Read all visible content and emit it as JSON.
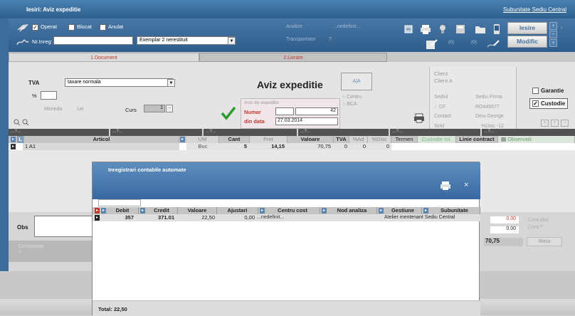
{
  "window": {
    "title": "Iesiri: Aviz expeditie",
    "subunit_link": "Subunitate Sediu Central"
  },
  "toolbar": {
    "operat": "Operat",
    "operat_checked": "✓",
    "blocat": "Blocat",
    "anulat": "Anulat",
    "nr_inreg": "Nr.Inreg:",
    "exemplar": "Exemplar 2 nerestituit",
    "analize": "Analize",
    "analize_val": "...nedefinit...",
    "transportator": "Transportator",
    "transportator_val": "?",
    "count_a": "(0)",
    "count_b": "(0)",
    "iesire": "Iesire",
    "modific": "Modific"
  },
  "tabs": {
    "document": "1.Document",
    "livrare": "2.Livrare"
  },
  "document": {
    "tva_label": "TVA",
    "tva_value": "taxare normala",
    "percent": "%",
    "moneda_label": "Moneda",
    "moneda_value": "Lei",
    "curs_label": "Curs",
    "curs_value": "1",
    "curs_btn": "...",
    "title": "Aviz expeditie",
    "subtitle": "Aviz de expeditie",
    "numar_label": "Numar",
    "numar_value": "42",
    "data_label": "din data",
    "data_value": "27.03.2014",
    "icon_text": "A|A",
    "centru": "Centru",
    "bca": "BCA",
    "client_label": "Client",
    "client_value": "Client A",
    "sediul": "Sediul",
    "sediu_value": "Sediu Firma",
    "cf": "CF",
    "cf_value": "RO445577",
    "contact": "Contact",
    "contact_value": "Dinu George",
    "sold": "Sold",
    "discount": "%Disc -12",
    "garantie": "Garantie",
    "custodie": "Custodie",
    "custodie_checked": "✓"
  },
  "filter_row": [
    "...?...",
    "...?...",
    "...?...",
    "...?...",
    "...?...",
    "...?..."
  ],
  "main_table": {
    "headers": {
      "l": "L",
      "articol": "Articol",
      "um": "UM",
      "cant": "Cant",
      "pret": "Pret",
      "valoare": "Valoare",
      "tva": "TVA",
      "ad": "%Ad",
      "disc": "%Disc",
      "termen": "Termen",
      "custodie_int": "Custodie Int.",
      "linie_contract": "Linie contract",
      "observatii": "Observatii"
    },
    "row": {
      "articol": "1 A1",
      "um": "Buc",
      "cant": "5",
      "pret": "14,15",
      "valoare": "70,75",
      "tva": "0",
      "ad": "0",
      "disc": "0"
    }
  },
  "bottom": {
    "obs_label": "Obs",
    "comision_label": "Comisionar",
    "comision_value": "?"
  },
  "right_values": {
    "v1": "0.00",
    "v2": "0.00",
    "total": "70,75",
    "cont_disc": "Cont disc",
    "cont": "Cont ?",
    "masa": "Masa"
  },
  "modal": {
    "title": "Inregistrari contabile automate",
    "close": "×",
    "headers": [
      "Debit",
      "Credit",
      "Valoare",
      "Ajustari",
      "Centru cost",
      "Nod analiza",
      "Gestiune",
      "Subunitate"
    ],
    "row": {
      "debit": "357",
      "credit": "371.01",
      "valoare": "22,50",
      "ajustari": "0,00",
      "centru": "...nedefinit...",
      "gestiune": "Atelier mentenant Sediu Central"
    },
    "total": "Total: 22,50"
  },
  "colors": {
    "title_blue": "#2d5f8e",
    "accent_red": "#c0392b",
    "check_green": "#2f9a2f",
    "pink": "#f7e9ef"
  }
}
